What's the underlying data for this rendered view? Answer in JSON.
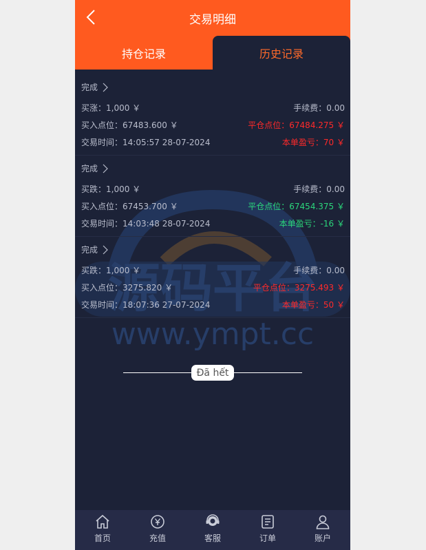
{
  "header": {
    "title": "交易明细",
    "tabs": [
      {
        "label": "持仓记录",
        "active": false
      },
      {
        "label": "历史记录",
        "active": true
      }
    ]
  },
  "colors": {
    "accent": "#ff5a1f",
    "background": "#1c2237",
    "profit": "#ff2a2a",
    "loss": "#2bd67b"
  },
  "records": [
    {
      "status": "完成",
      "direction": "买涨：1,000 ￥",
      "fee": "手续费：0.00",
      "buy_point": "买入点位：67483.600 ￥",
      "close_point": "平仓点位：67484.275 ￥",
      "time": "交易时间：14:05:57 28-07-2024",
      "pnl": "本单盈亏：70 ￥",
      "tone": "red"
    },
    {
      "status": "完成",
      "direction": "买跌：1,000 ￥",
      "fee": "手续费：0.00",
      "buy_point": "买入点位：67453.700 ￥",
      "close_point": "平仓点位：67454.375 ￥",
      "time": "交易时间：14:03:48 28-07-2024",
      "pnl": "本单盈亏：-16 ￥",
      "tone": "green"
    },
    {
      "status": "完成",
      "direction": "买跌：1,000 ￥",
      "fee": "手续费：0.00",
      "buy_point": "买入点位：3275.820 ￥",
      "close_point": "平仓点位：3275.493 ￥",
      "time": "交易时间：18:07:36 27-07-2024",
      "pnl": "本单盈亏：50 ￥",
      "tone": "red"
    }
  ],
  "end_text": "Đã hết",
  "watermark": {
    "title": "源码平台",
    "url": "www.ympt.cc"
  },
  "tabbar": [
    {
      "label": "首页",
      "icon": "home-icon"
    },
    {
      "label": "充值",
      "icon": "recharge-icon"
    },
    {
      "label": "客服",
      "icon": "customer-service-icon"
    },
    {
      "label": "订单",
      "icon": "order-icon"
    },
    {
      "label": "账户",
      "icon": "account-icon"
    }
  ]
}
